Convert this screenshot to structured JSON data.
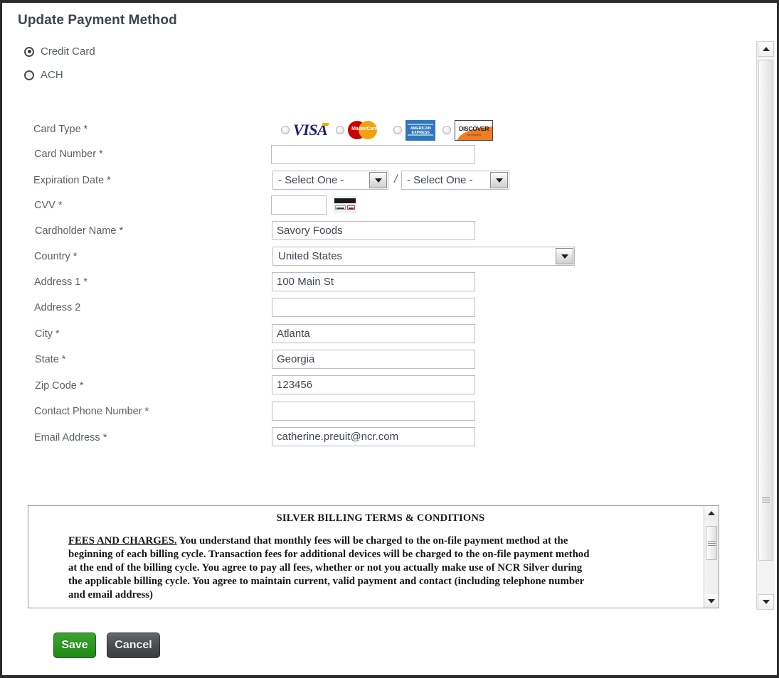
{
  "page": {
    "title": "Update Payment Method"
  },
  "payment_method": {
    "options": [
      {
        "label": "Credit Card",
        "selected": true
      },
      {
        "label": "ACH",
        "selected": false
      }
    ]
  },
  "form": {
    "labels": {
      "card_type": "Card Type *",
      "card_number": "Card Number *",
      "expiration_date": "Expiration Date *",
      "cvv": "CVV *",
      "cardholder_name": "Cardholder Name *",
      "country": "Country *",
      "address1": "Address 1 *",
      "address2": "Address 2",
      "city": "City *",
      "state": "State *",
      "zip_code": "Zip Code *",
      "contact_phone": "Contact Phone Number *",
      "email": "Email Address *"
    },
    "card_types": [
      {
        "name": "visa",
        "label": "VISA",
        "selected": false
      },
      {
        "name": "mastercard",
        "label": "MasterCard",
        "selected": false
      },
      {
        "name": "amex",
        "label": "AMERICAN EXPRESS",
        "selected": false
      },
      {
        "name": "discover",
        "label": "DISCOVER",
        "sub": "NETWORK",
        "selected": false
      }
    ],
    "values": {
      "card_number": "",
      "exp_month": "- Select One -",
      "exp_separator": "/",
      "exp_year": "- Select One -",
      "cvv": "",
      "cardholder_name": "Savory Foods",
      "country": "United States",
      "address1": "100 Main St",
      "address2": "",
      "city": "Atlanta",
      "state": "Georgia",
      "zip_code": "123456",
      "contact_phone": "",
      "email": "catherine.preuit@ncr.com"
    }
  },
  "terms": {
    "title": "SILVER BILLING TERMS & CONDITIONS",
    "lead": "FEES AND CHARGES.",
    "body": " You understand that monthly fees will be charged to the on-file payment method at the beginning of each billing cycle. Transaction fees for additional devices will be charged to the on-file payment method at the end of the billing cycle. You agree to pay all fees, whether or not you actually make use of NCR Silver during the applicable billing cycle. You agree to maintain current, valid payment and contact (including telephone number and email address)"
  },
  "actions": {
    "save": "Save",
    "cancel": "Cancel"
  },
  "colors": {
    "save_green": "#2b9a21",
    "cancel_gray": "#4c4f52",
    "visa_blue": "#1a1f71",
    "mastercard_red": "#cc0000",
    "mastercard_orange": "#f2a20c",
    "amex_blue": "#2e77bc",
    "discover_orange": "#f07d22"
  }
}
